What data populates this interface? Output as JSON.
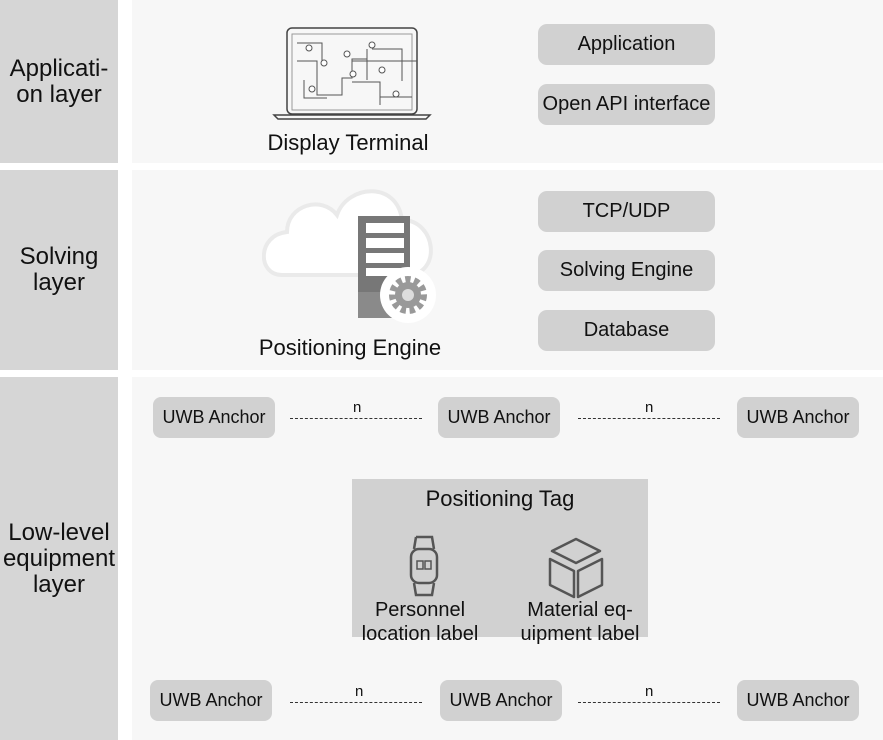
{
  "layers": [
    {
      "label": "Applicati-\non layer"
    },
    {
      "label": "Solving\nlayer"
    },
    {
      "label": "Low-level\nequipment\nlayer"
    }
  ],
  "application": {
    "terminal_label": "Display Terminal",
    "boxes": [
      "Application",
      "Open API interface"
    ]
  },
  "solving": {
    "engine_label": "Positioning Engine",
    "boxes": [
      "TCP/UDP",
      "Solving Engine",
      "Database"
    ]
  },
  "equipment": {
    "top_anchors": [
      "UWB Anchor",
      "UWB Anchor",
      "UWB Anchor"
    ],
    "bottom_anchors": [
      "UWB Anchor",
      "UWB Anchor",
      "UWB Anchor"
    ],
    "link_label": "n",
    "tag": {
      "title": "Positioning Tag",
      "personnel": "Personnel\nlocation label",
      "material": "Material eq-\nuipment label"
    }
  },
  "colors": {
    "layer_bg": "#d6d6d6",
    "panel_bg": "#f7f7f7",
    "box_bg": "#d1d1d1"
  }
}
